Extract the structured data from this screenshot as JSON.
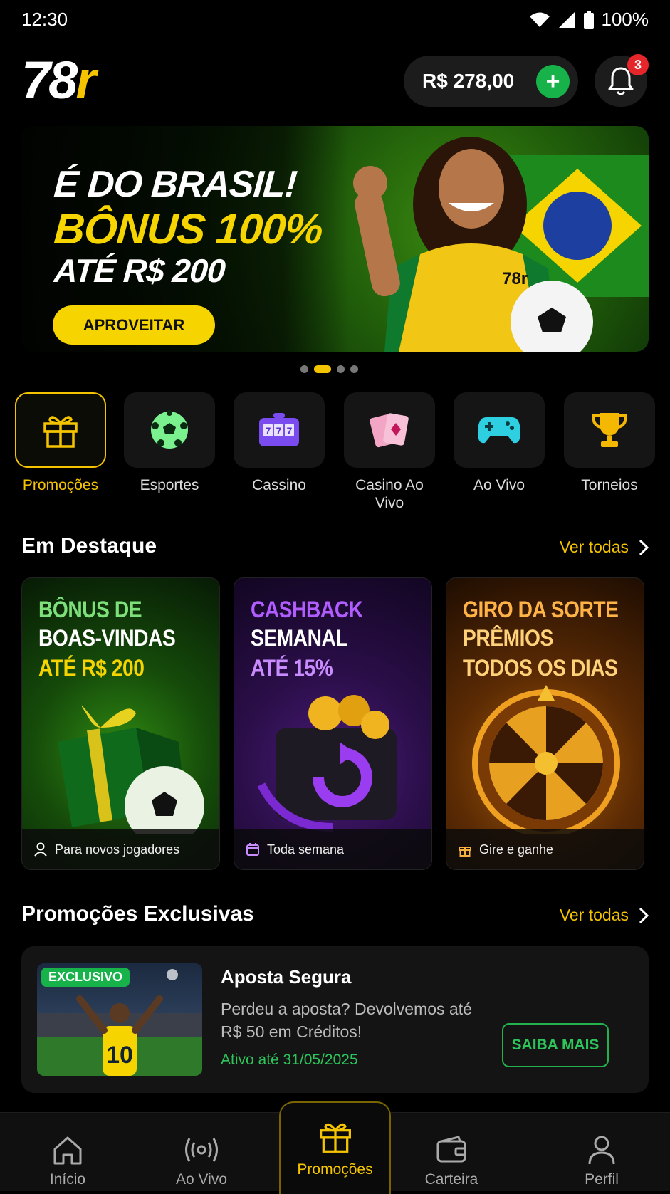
{
  "status": {
    "time": "12:30",
    "battery": "100%"
  },
  "header": {
    "logo_main": "78",
    "logo_accent": "r",
    "balance": "R$ 278,00",
    "add_label": "+",
    "notifications_count": "3"
  },
  "hero": {
    "line1": "É DO BRASIL!",
    "line2": "BÔNUS 100%",
    "line3": "ATÉ R$ 200",
    "cta": "APROVEITAR",
    "shirt_logo": "78r",
    "slide_index": 2,
    "slide_count": 4
  },
  "categories": [
    {
      "label": "Promoções",
      "icon": "gift-icon",
      "active": true
    },
    {
      "label": "Esportes",
      "icon": "soccer-ball-icon",
      "active": false
    },
    {
      "label": "Cassino",
      "icon": "slot-machine-icon",
      "active": false
    },
    {
      "label": "Casino Ao Vivo",
      "icon": "playing-cards-icon",
      "active": false
    },
    {
      "label": "Ao Vivo",
      "icon": "gamepad-icon",
      "active": false
    },
    {
      "label": "Torneios",
      "icon": "trophy-icon",
      "active": false
    }
  ],
  "featured": {
    "title": "Em Destaque",
    "see_all": "Ver todas",
    "cards": [
      {
        "line1": "BÔNUS DE",
        "line2": "BOAS-VINDAS",
        "line3": "ATÉ R$ 200",
        "footer": "Para novos jogadores",
        "footer_icon": "user-icon"
      },
      {
        "line1": "CASHBACK",
        "line2": "SEMANAL",
        "line3": "ATÉ 15%",
        "footer": "Toda semana",
        "footer_icon": "calendar-icon"
      },
      {
        "line1": "GIRO DA SORTE",
        "line2": "PRÊMIOS",
        "line3": "TODOS OS DIAS",
        "footer": "Gire e ganhe",
        "footer_icon": "gift-icon"
      }
    ]
  },
  "exclusive": {
    "title": "Promoções Exclusivas",
    "see_all": "Ver todas",
    "card": {
      "badge": "EXCLUSIVO",
      "jersey_number": "10",
      "title": "Aposta Segura",
      "description": "Perdeu a aposta? Devolvemos até R$ 50 em Créditos!",
      "valid_until": "Ativo até 31/05/2025",
      "cta": "SAIBA MAIS"
    }
  },
  "bottom_nav": [
    {
      "label": "Início",
      "icon": "home-icon",
      "active": false
    },
    {
      "label": "Ao Vivo",
      "icon": "live-broadcast-icon",
      "active": false
    },
    {
      "label": "Promoções",
      "icon": "gift-icon",
      "active": true
    },
    {
      "label": "Carteira",
      "icon": "wallet-icon",
      "active": false
    },
    {
      "label": "Perfil",
      "icon": "profile-icon",
      "active": false
    }
  ],
  "colors": {
    "accent": "#f5c400",
    "green": "#18b24a",
    "background": "#000000"
  }
}
